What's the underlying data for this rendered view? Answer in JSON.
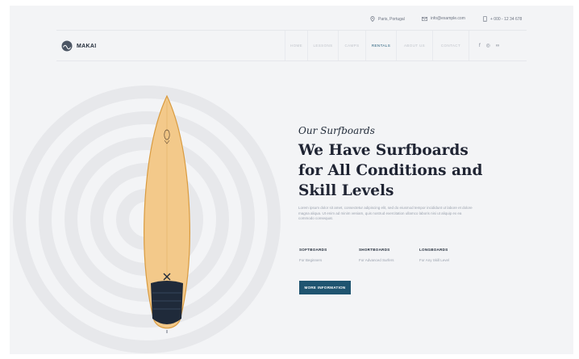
{
  "topbar": {
    "location": "Paris, Portugal",
    "email": "info@example.com",
    "phone": "+ 000 - 12 34 678"
  },
  "logo": {
    "text": "MAKAI"
  },
  "nav": {
    "items": [
      {
        "label": "HOME",
        "active": false
      },
      {
        "label": "LESSONS",
        "active": false
      },
      {
        "label": "CAMPS",
        "active": false
      },
      {
        "label": "RENTALS",
        "active": true
      },
      {
        "label": "ABOUT US",
        "active": false
      },
      {
        "label": "CONTACT",
        "active": false
      }
    ],
    "social": {
      "facebook": "f",
      "instagram": "◎",
      "tripadvisor": "∞"
    }
  },
  "hero": {
    "script_title": "Our Surfboards",
    "headline_lines": [
      "We Have Surfboards",
      "for All Conditions and",
      "Skill Levels"
    ],
    "paragraph": "Lorem ipsum dolor sit amet, consectetur adipiscing elit, sed do eiusmod tempor incididunt ut labore et dolore magna aliqua. Ut enim ad minim veniam, quis nostrud exercitation ullamco laboris nisi ut aliquip ex ea commodo consequat.",
    "categories": [
      {
        "title": "SOFTBOARDS",
        "subtitle": "For Beginners"
      },
      {
        "title": "SHORTBOARDS",
        "subtitle": "For Advanced Surfers"
      },
      {
        "title": "LONGBOARDS",
        "subtitle": "For Any Skill Level"
      }
    ],
    "button_label": "MORE INFORMATION"
  },
  "colors": {
    "accent": "#1f5470",
    "page_background": "#f3f4f6",
    "board": "#f3c98a",
    "headline": "#1f2433"
  }
}
